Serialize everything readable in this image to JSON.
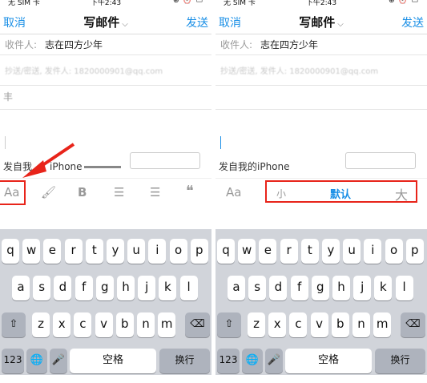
{
  "status": {
    "carrier": "无 SIM 卡",
    "time": "下午2:43",
    "icons": "⊕ ⏰ ▭"
  },
  "nav": {
    "cancel": "取消",
    "title": "写邮件",
    "send": "发送"
  },
  "compose": {
    "to_label": "收件人:",
    "to_value": "志在四方少年",
    "cc_text": "抄送/密送, 发件人: 1820000901@qq.com",
    "subject_char": "丰",
    "left_signature": "发自我",
    "left_signature_tail": "iPhone",
    "right_signature": "发自我的iPhone"
  },
  "toolbar": {
    "aa": "Aa",
    "fill": "🖌",
    "bold": "B",
    "list": "☰",
    "align": "☰",
    "quote": "❝"
  },
  "size_options": {
    "small": "小",
    "default": "默认",
    "large": "大"
  },
  "colors": {
    "accent": "#1a8fe6",
    "highlight": "#e8241a"
  },
  "keyboard": {
    "row1": [
      "q",
      "w",
      "e",
      "r",
      "t",
      "y",
      "u",
      "i",
      "o",
      "p"
    ],
    "row2": [
      "a",
      "s",
      "d",
      "f",
      "g",
      "h",
      "j",
      "k",
      "l"
    ],
    "row3": [
      "z",
      "x",
      "c",
      "v",
      "b",
      "n",
      "m"
    ],
    "shift": "⇧",
    "delete": "⌫",
    "num": "123",
    "globe": "🌐",
    "mic": "🎤",
    "space": "空格",
    "return": "换行"
  }
}
